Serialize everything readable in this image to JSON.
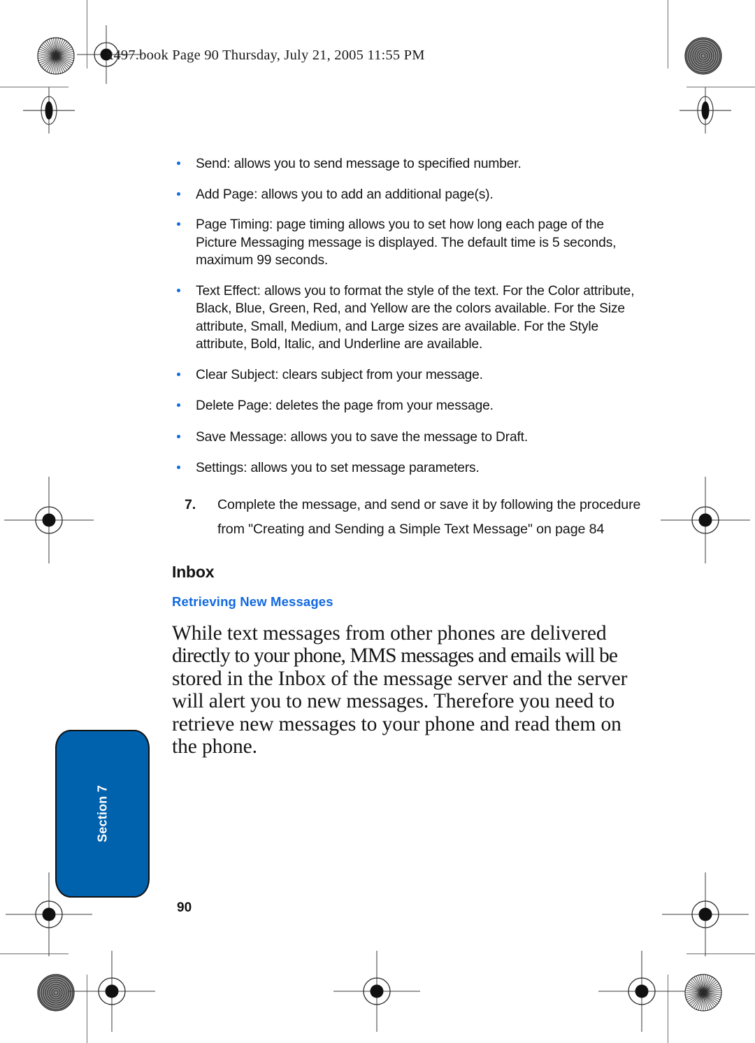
{
  "header": {
    "file_line": "x497.book  Page 90  Thursday, July 21, 2005  11:55 PM"
  },
  "content": {
    "bullets": [
      "Send: allows you to send message to specified number.",
      "Add Page: allows you to add an additional page(s).",
      "Page Timing: page timing allows you to set how long each page of the Picture Messaging message is displayed. The default time is 5 seconds, maximum 99 seconds.",
      "Text Effect: allows you to format the style of the text. For the Color attribute, Black, Blue, Green, Red, and Yellow are the colors available. For the Size attribute, Small, Medium, and Large sizes are available. For the Style attribute, Bold, Italic, and Underline are available.",
      "Clear Subject: clears subject from your message.",
      "Delete Page: deletes the page from your message.",
      "Save Message: allows you to save the message to Draft.",
      "Settings: allows you to set message parameters."
    ],
    "step": {
      "number": "7.",
      "text": "Complete the message, and send or save it by following the procedure from \"Creating and Sending a Simple Text Message\" on page 84"
    },
    "heading_main": "Inbox",
    "heading_sub": "Retrieving New Messages",
    "paragraph_lines": [
      "While text messages from other phones are delivered",
      "directly to your phone, MMS messages and emails will be",
      "stored in the Inbox of the message server and the server",
      "will alert you to new messages. Therefore you need to",
      "retrieve new messages to your phone and read them on",
      "the phone."
    ]
  },
  "section_tab": {
    "label": "Section 7",
    "color": "#0061ad"
  },
  "footer": {
    "page_number": "90"
  },
  "colors": {
    "accent_blue": "#1169e0",
    "tab_blue": "#0061ad",
    "text_black": "#141414"
  }
}
